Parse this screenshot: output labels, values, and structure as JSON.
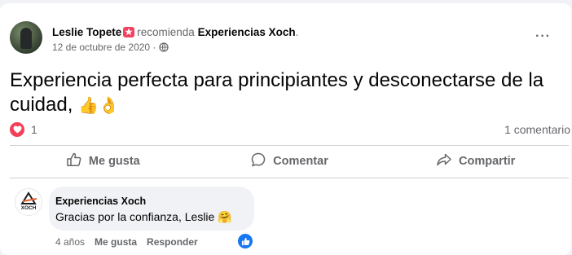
{
  "post": {
    "author": "Leslie Topete",
    "action_text": "recomienda",
    "page_name": "Experiencias Xoch",
    "page_suffix": ".",
    "date": "12 de octubre de 2020 ·",
    "icons": {
      "recommend_badge": "recommend-star-icon",
      "privacy": "globe-icon",
      "more": "more-options-icon"
    },
    "text": "Experiencia perfecta para principiantes y desconectarse de la cuidad, ",
    "text_emojis": "👍👌",
    "reaction_count": "1",
    "comment_count": "1 comentario"
  },
  "actions": {
    "like": "Me gusta",
    "comment": "Comentar",
    "share": "Compartir"
  },
  "comment": {
    "author": "Experiencias Xoch",
    "avatar_text": "XOCH",
    "text": "Gracias por la confianza, Leslie ",
    "emoji": "🤗",
    "time": "4 años",
    "like_label": "Me gusta",
    "reply_label": "Responder"
  },
  "colors": {
    "accent_blue": "#1877f2",
    "heart_red": "#f33e58",
    "muted_text": "#65676b"
  }
}
